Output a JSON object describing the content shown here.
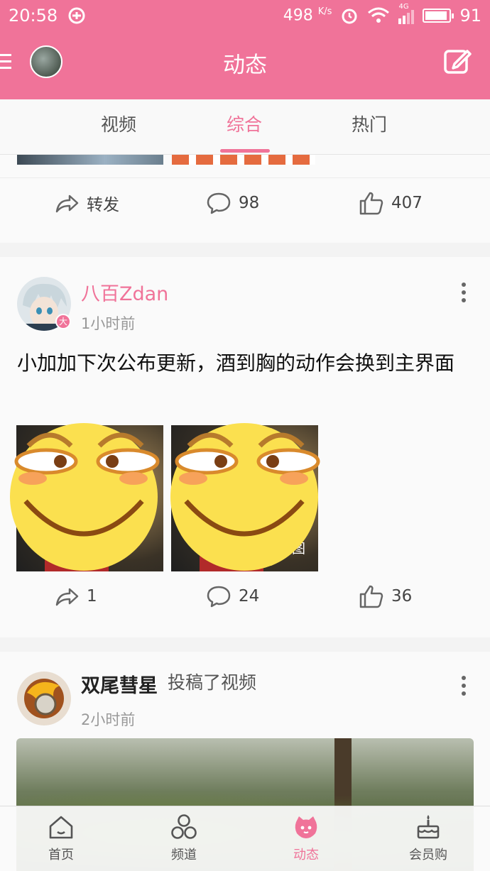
{
  "status_bar": {
    "time": "20:58",
    "net_speed": "498",
    "net_unit": "K/s",
    "signal": "4G",
    "battery": "91",
    "battery_level": 0.91
  },
  "header": {
    "title": "动态",
    "avatar_icon": "user-avatar",
    "edit_icon": "edit-icon",
    "menu_icon": "menu-icon"
  },
  "tabs": [
    {
      "label": "视频",
      "active": false
    },
    {
      "label": "综合",
      "active": true
    },
    {
      "label": "热门",
      "active": false
    }
  ],
  "posts": [
    {
      "actions": {
        "share": "转发",
        "comments": "98",
        "likes": "407"
      }
    },
    {
      "username": "八百Zdan",
      "time": "1小时前",
      "text": "小加加下次公布更新，酒到胸的动作会换到主界面",
      "badge": "大",
      "image_label": "动图",
      "actions": {
        "share": "1",
        "comments": "24",
        "likes": "36"
      }
    },
    {
      "username": "双尾彗星",
      "action_text": "投稿了视频",
      "time": "2小时前"
    }
  ],
  "bottom_nav": [
    {
      "label": "首页",
      "icon": "home-icon"
    },
    {
      "label": "频道",
      "icon": "channel-icon"
    },
    {
      "label": "动态",
      "icon": "dynamic-icon",
      "active": true
    },
    {
      "label": "会员购",
      "icon": "cake-icon"
    }
  ],
  "colors": {
    "accent": "#f07399",
    "text": "#222222",
    "muted": "#999999"
  }
}
